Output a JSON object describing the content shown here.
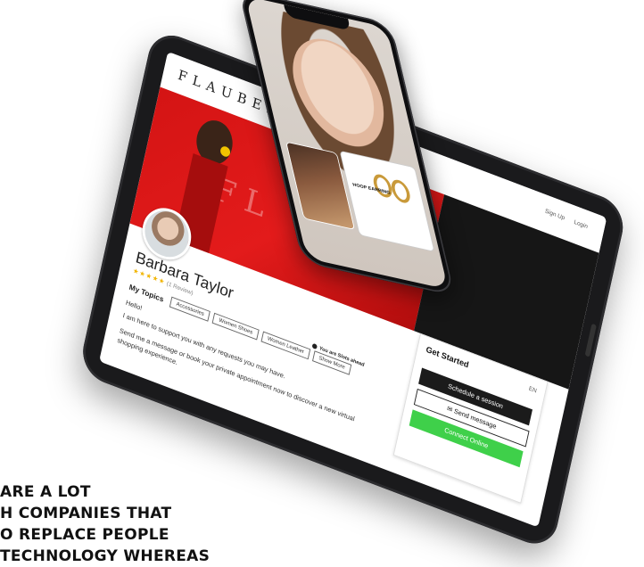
{
  "site": {
    "brand": "FLAUBERT",
    "hero_text": "FL",
    "header_links": [
      "Sign Up",
      "Login"
    ]
  },
  "profile": {
    "name": "Barbara Taylor",
    "rating_text": "(1 Review)",
    "topics_label": "My Topics",
    "topics": [
      "Accessories",
      "Women Shoes",
      "Women Leather",
      "Show More"
    ],
    "greeting": "Hello!",
    "intro": "I am here to support you with any requests you may have.",
    "cta": "Send me a message or book your private appointment now to discover a new virtual shopping experience.",
    "status": "You are Slots ahead"
  },
  "panel": {
    "title": "Get Started",
    "language": "EN",
    "schedule_label": "Schedule a session",
    "message_label": "Send message",
    "connect_label": "Connect Online"
  },
  "phone": {
    "product_title": "HOOP EARRING"
  },
  "headline": {
    "lines": [
      "ARE A LOT",
      "H COMPANIES THAT",
      "O REPLACE PEOPLE",
      "TECHNOLOGY WHEREAS"
    ]
  }
}
